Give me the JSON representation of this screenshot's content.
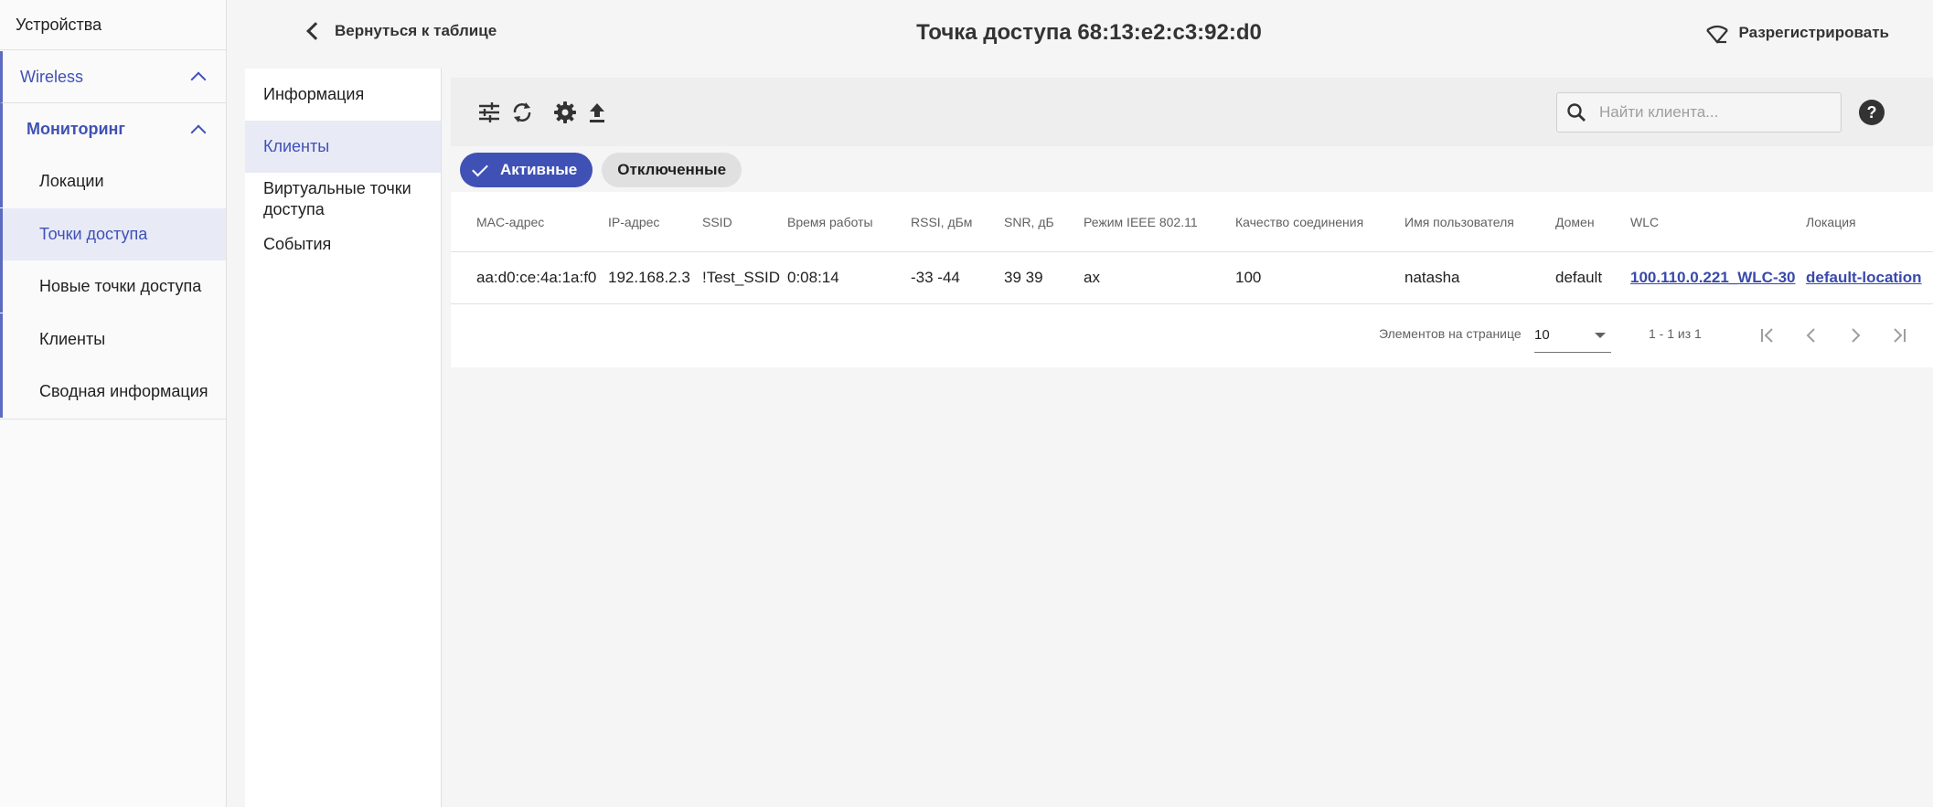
{
  "sidebar": {
    "devices": "Устройства",
    "wireless": "Wireless",
    "monitoring": "Мониторинг",
    "items": [
      {
        "label": "Локации"
      },
      {
        "label": "Точки доступа"
      },
      {
        "label": "Новые точки доступа"
      },
      {
        "label": "Клиенты"
      },
      {
        "label": "Сводная информация"
      }
    ],
    "active_item": "Точки доступа"
  },
  "header": {
    "back_label": "Вернуться к таблице",
    "title": "Точка доступа 68:13:e2:c3:92:d0",
    "unregister_label": "Разрегистрировать"
  },
  "subnav": {
    "items": [
      {
        "label": "Информация"
      },
      {
        "label": "Клиенты"
      },
      {
        "label": "Виртуальные точки доступа"
      },
      {
        "label": "События"
      }
    ],
    "active_item": "Клиенты"
  },
  "toolbar": {
    "icons": [
      "filter-icon",
      "refresh-icon",
      "settings-icon",
      "export-icon"
    ],
    "search_placeholder": "Найти клиента...",
    "help_label": "?"
  },
  "chips": {
    "active": "Активные",
    "disconnected": "Отключенные"
  },
  "table": {
    "columns": [
      "MAC-адрес",
      "IP-адрес",
      "SSID",
      "Время работы",
      "RSSI, дБм",
      "SNR, дБ",
      "Режим IEEE 802.11",
      "Качество соединения",
      "Имя пользователя",
      "Домен",
      "WLC",
      "Локация"
    ],
    "rows": [
      {
        "mac": "aa:d0:ce:4a:1a:f0",
        "ip": "192.168.2.3",
        "ssid": "!Test_SSID",
        "uptime": "0:08:14",
        "rssi": "-33 -44",
        "snr": "39 39",
        "mode": "ax",
        "quality": "100",
        "username": "natasha",
        "domain": "default",
        "wlc": "100.110.0.221_WLC-30",
        "location": "default-location"
      }
    ]
  },
  "paginator": {
    "items_per_page_label": "Элементов на странице",
    "page_size": "10",
    "range": "1 - 1 из 1"
  },
  "colors": {
    "accent": "#3f51b5",
    "active_bg": "#e8eaf6",
    "background": "#f5f5f5"
  }
}
